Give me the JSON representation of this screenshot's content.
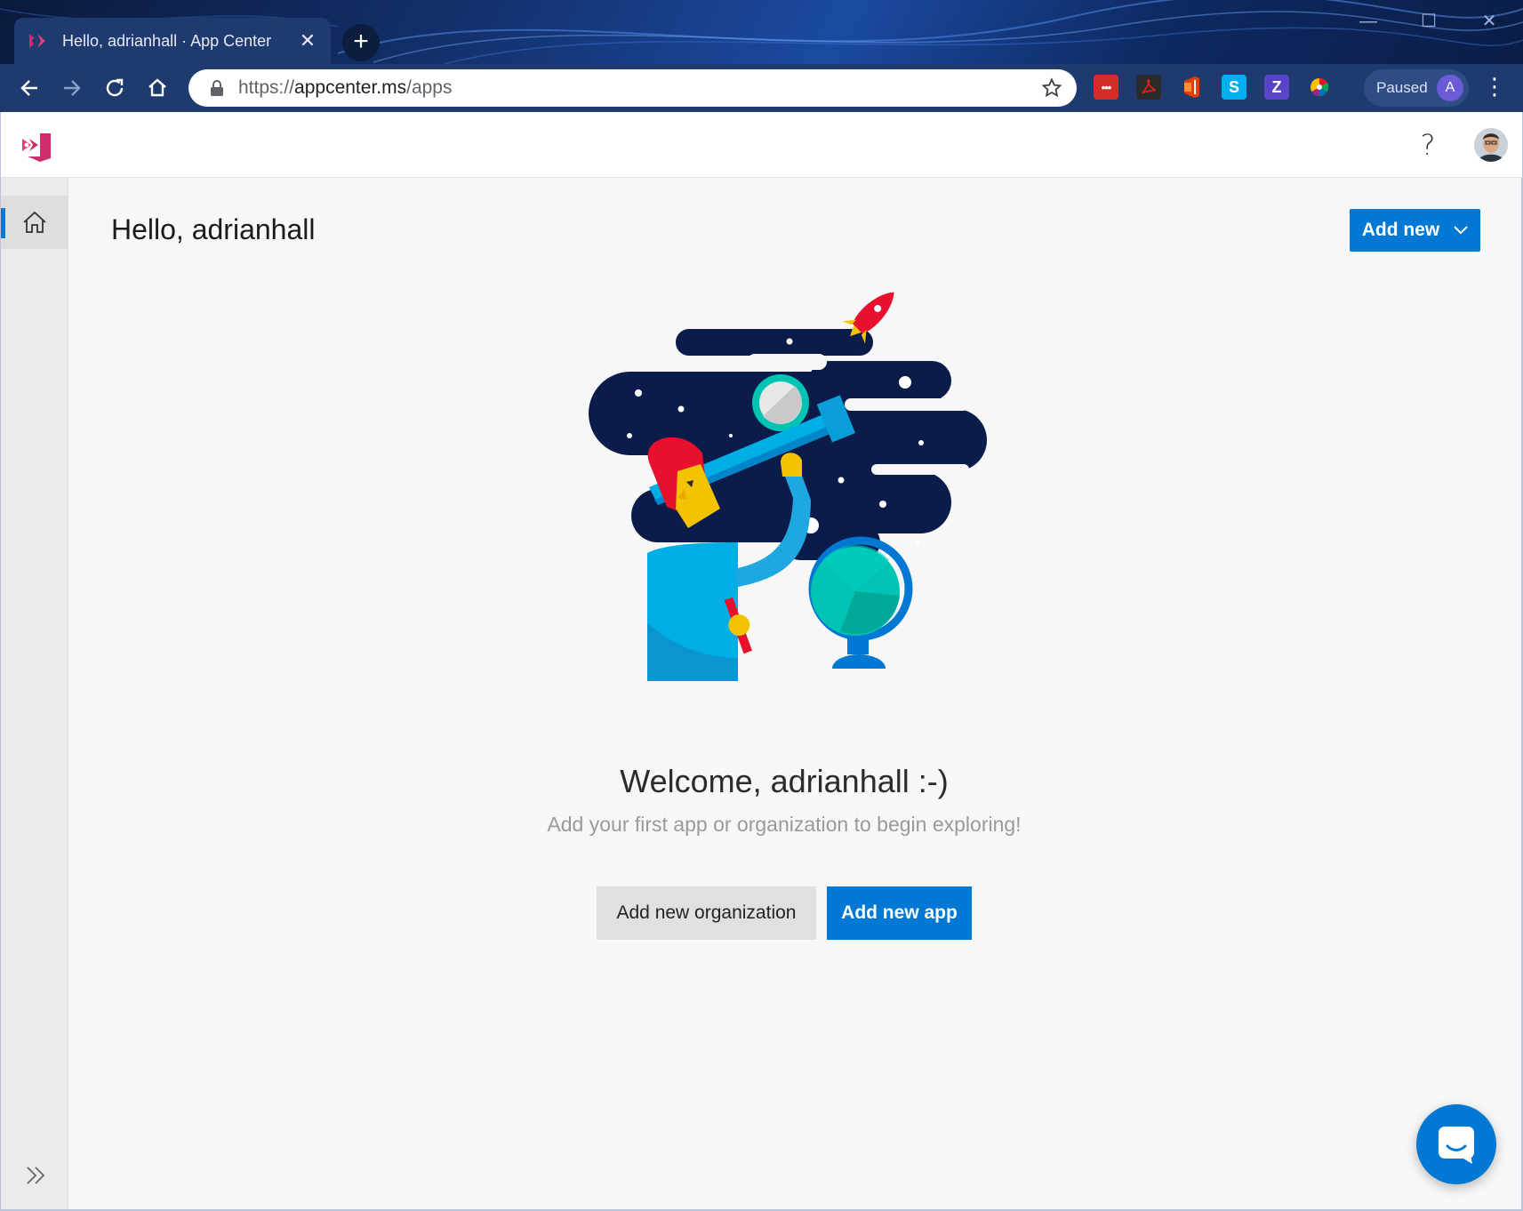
{
  "browser": {
    "tab_title": "Hello, adrianhall · App Center",
    "tab_close": "✕",
    "new_tab": "+",
    "url_scheme": "https://",
    "url_host": "appcenter.ms",
    "url_path": "/apps",
    "profile_status": "Paused",
    "profile_initial": "A",
    "window_controls": {
      "minimize": "—",
      "maximize": "☐",
      "close": "✕"
    },
    "menu_glyph": "⋮",
    "extensions": [
      {
        "name": "lastpass-icon",
        "color": "#d32d27",
        "glyph": "•••"
      },
      {
        "name": "acrobat-icon",
        "color": "#2b2b2b",
        "glyph": ""
      },
      {
        "name": "office-icon",
        "color": "#eb3c00",
        "glyph": ""
      },
      {
        "name": "skype-s-icon",
        "color": "#00aff0",
        "glyph": "S"
      },
      {
        "name": "z-extension-icon",
        "color": "#5a43c6",
        "glyph": "Z"
      },
      {
        "name": "color-wheel-icon",
        "color": "#ffffff",
        "glyph": ""
      }
    ]
  },
  "app": {
    "colors": {
      "accent": "#0078d4",
      "brand": "#cb2e6d"
    },
    "help_glyph": "?",
    "sidebar": {
      "active_item": "home-icon"
    }
  },
  "main": {
    "title": "Hello, adrianhall",
    "add_new_label": "Add new",
    "welcome_heading": "Welcome, adrianhall :-)",
    "welcome_sub": "Add your first app or organization to begin exploring!",
    "btn_org": "Add new organization",
    "btn_app": "Add new app"
  }
}
